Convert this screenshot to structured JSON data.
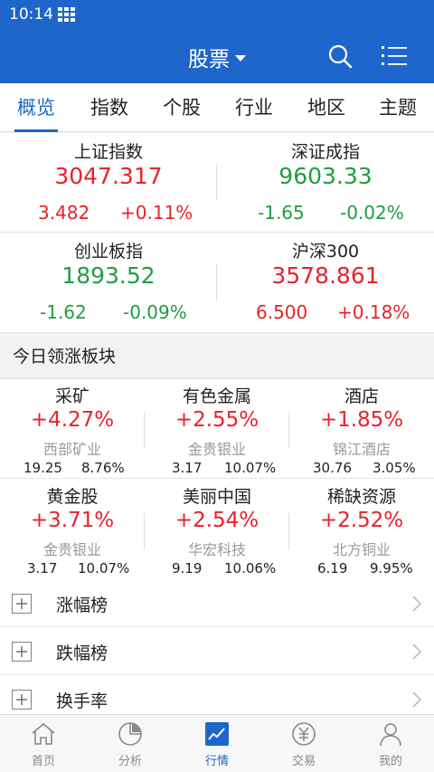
{
  "status": {
    "time": "10:14"
  },
  "header": {
    "title": "股票"
  },
  "tabs": [
    "概览",
    "指数",
    "个股",
    "行业",
    "地区",
    "主题"
  ],
  "indices": [
    {
      "name": "上证指数",
      "price": "3047.317",
      "change": "3.482",
      "pct": "+0.11%",
      "trend": "up"
    },
    {
      "name": "深证成指",
      "price": "9603.33",
      "change": "-1.65",
      "pct": "-0.02%",
      "trend": "down"
    },
    {
      "name": "创业板指",
      "price": "1893.52",
      "change": "-1.62",
      "pct": "-0.09%",
      "trend": "down"
    },
    {
      "name": "沪深300",
      "price": "3578.861",
      "change": "6.500",
      "pct": "+0.18%",
      "trend": "up"
    }
  ],
  "sectors_title": "今日领涨板块",
  "sectors": [
    {
      "name": "采矿",
      "pct": "+4.27%",
      "stock": "西部矿业",
      "price": "19.25",
      "stock_pct": "8.76%"
    },
    {
      "name": "有色金属",
      "pct": "+2.55%",
      "stock": "金贵银业",
      "price": "3.17",
      "stock_pct": "10.07%"
    },
    {
      "name": "酒店",
      "pct": "+1.85%",
      "stock": "锦江酒店",
      "price": "30.76",
      "stock_pct": "3.05%"
    },
    {
      "name": "黄金股",
      "pct": "+3.71%",
      "stock": "金贵银业",
      "price": "3.17",
      "stock_pct": "10.07%"
    },
    {
      "name": "美丽中国",
      "pct": "+2.54%",
      "stock": "华宏科技",
      "price": "9.19",
      "stock_pct": "10.06%"
    },
    {
      "name": "稀缺资源",
      "pct": "+2.52%",
      "stock": "北方铜业",
      "price": "6.19",
      "stock_pct": "9.95%"
    }
  ],
  "rankings": [
    "涨幅榜",
    "跌幅榜",
    "换手率"
  ],
  "bottom_nav": [
    {
      "label": "首页",
      "icon": "home-icon"
    },
    {
      "label": "分析",
      "icon": "pie-chart-icon"
    },
    {
      "label": "行情",
      "icon": "market-chart-icon"
    },
    {
      "label": "交易",
      "icon": "yuan-coin-icon"
    },
    {
      "label": "我的",
      "icon": "person-icon"
    }
  ],
  "colors": {
    "primary": "#1e66cc",
    "up": "#e8222a",
    "down": "#1f9e3e"
  }
}
